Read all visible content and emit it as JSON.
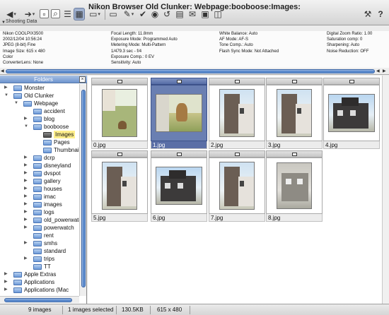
{
  "window": {
    "title": "Nikon Browser Old Clunker: Webpage:booboose:Images:"
  },
  "toolbar": {
    "icons": [
      "back-arrow-icon",
      "forward-arrow-icon",
      "view-icon",
      "search-icon",
      "list-view-icon",
      "thumbnail-view-icon",
      "photo-icon",
      "folder-icon",
      "edit-icon",
      "checkmark-icon",
      "transfer-icon",
      "rotate-left-icon",
      "print-icon",
      "email-icon",
      "crop-icon",
      "web-icon",
      "tools-icon",
      "help-icon"
    ]
  },
  "shooting": {
    "title": "Shooting Data",
    "col1": [
      "Nikon COOLPIX3500",
      "2002/12/04 10:56:24",
      "JPEG (8-bit) Fine",
      "Image Size:  615 x 480",
      "Color",
      "ConverterLens: None"
    ],
    "col2": [
      "Focal Length: 11.8mm",
      "Exposure Mode: Programmed Auto",
      "Metering Mode: Multi-Pattern",
      "1/479.3 sec - f/4",
      "Exposure Comp.: 0 EV",
      "Sensitivity: Auto"
    ],
    "col3": [
      "White Balance: Auto",
      "AF Mode: AF-S",
      "Tone Comp.: Auto",
      "Flash Sync Mode: Not Attached"
    ],
    "col4": [
      "Digital Zoom Ratio: 1.00",
      "Saturation comp: 0",
      "Sharpening: Auto",
      "Noise Reduction: OFF"
    ]
  },
  "folders": {
    "title": "Folders",
    "items": [
      {
        "label": "Monster",
        "depth": 0,
        "tri": "right",
        "type": "folder"
      },
      {
        "label": "Old Clunker",
        "depth": 0,
        "tri": "down",
        "type": "folder"
      },
      {
        "label": "Webpage",
        "depth": 1,
        "tri": "down",
        "type": "folder"
      },
      {
        "label": "accident",
        "depth": 2,
        "tri": "none",
        "type": "folder"
      },
      {
        "label": "blog",
        "depth": 2,
        "tri": "right",
        "type": "folder"
      },
      {
        "label": "booboose",
        "depth": 2,
        "tri": "down",
        "type": "folder"
      },
      {
        "label": "Images",
        "depth": 3,
        "tri": "none",
        "type": "dark",
        "highlight": true
      },
      {
        "label": "Pages",
        "depth": 3,
        "tri": "none",
        "type": "folder"
      },
      {
        "label": "Thumbnails",
        "depth": 3,
        "tri": "none",
        "type": "folder"
      },
      {
        "label": "dcrp",
        "depth": 2,
        "tri": "right",
        "type": "folder"
      },
      {
        "label": "disneyland",
        "depth": 2,
        "tri": "right",
        "type": "folder"
      },
      {
        "label": "dvspot",
        "depth": 2,
        "tri": "right",
        "type": "folder"
      },
      {
        "label": "gallery",
        "depth": 2,
        "tri": "right",
        "type": "folder"
      },
      {
        "label": "houses",
        "depth": 2,
        "tri": "right",
        "type": "folder"
      },
      {
        "label": "imac",
        "depth": 2,
        "tri": "right",
        "type": "folder"
      },
      {
        "label": "images",
        "depth": 2,
        "tri": "right",
        "type": "folder"
      },
      {
        "label": "logs",
        "depth": 2,
        "tri": "right",
        "type": "folder"
      },
      {
        "label": "old_powerwatch",
        "depth": 2,
        "tri": "right",
        "type": "folder"
      },
      {
        "label": "powerwatch",
        "depth": 2,
        "tri": "right",
        "type": "folder"
      },
      {
        "label": "rent",
        "depth": 2,
        "tri": "none",
        "type": "folder"
      },
      {
        "label": "smhs",
        "depth": 2,
        "tri": "right",
        "type": "folder"
      },
      {
        "label": "standard",
        "depth": 2,
        "tri": "none",
        "type": "folder"
      },
      {
        "label": "trips",
        "depth": 2,
        "tri": "right",
        "type": "folder"
      },
      {
        "label": "TT",
        "depth": 2,
        "tri": "none",
        "type": "folder"
      },
      {
        "label": "Apple Extras",
        "depth": 0,
        "tri": "right",
        "type": "folder"
      },
      {
        "label": "Applications",
        "depth": 0,
        "tri": "right",
        "type": "folder"
      },
      {
        "label": "Applications (Mac",
        "depth": 0,
        "tri": "right",
        "type": "folder"
      }
    ]
  },
  "thumbnails": [
    {
      "name": "0.jpg",
      "scene": "dog-lawn-tall"
    },
    {
      "name": "1.jpg",
      "scene": "dog-wide",
      "selected": true
    },
    {
      "name": "2.jpg",
      "scene": "house-tall"
    },
    {
      "name": "3.jpg",
      "scene": "house-tall"
    },
    {
      "name": "4.jpg",
      "scene": "house-wide"
    },
    {
      "name": "5.jpg",
      "scene": "house-tall"
    },
    {
      "name": "6.jpg",
      "scene": "house-wide"
    },
    {
      "name": "7.jpg",
      "scene": "house-tall"
    },
    {
      "name": "8.jpg",
      "scene": "house-wide-gray"
    }
  ],
  "status": {
    "count": "9 images",
    "selected": "1 images selected",
    "size": "130.5KB",
    "dimensions": "615 x 480"
  }
}
